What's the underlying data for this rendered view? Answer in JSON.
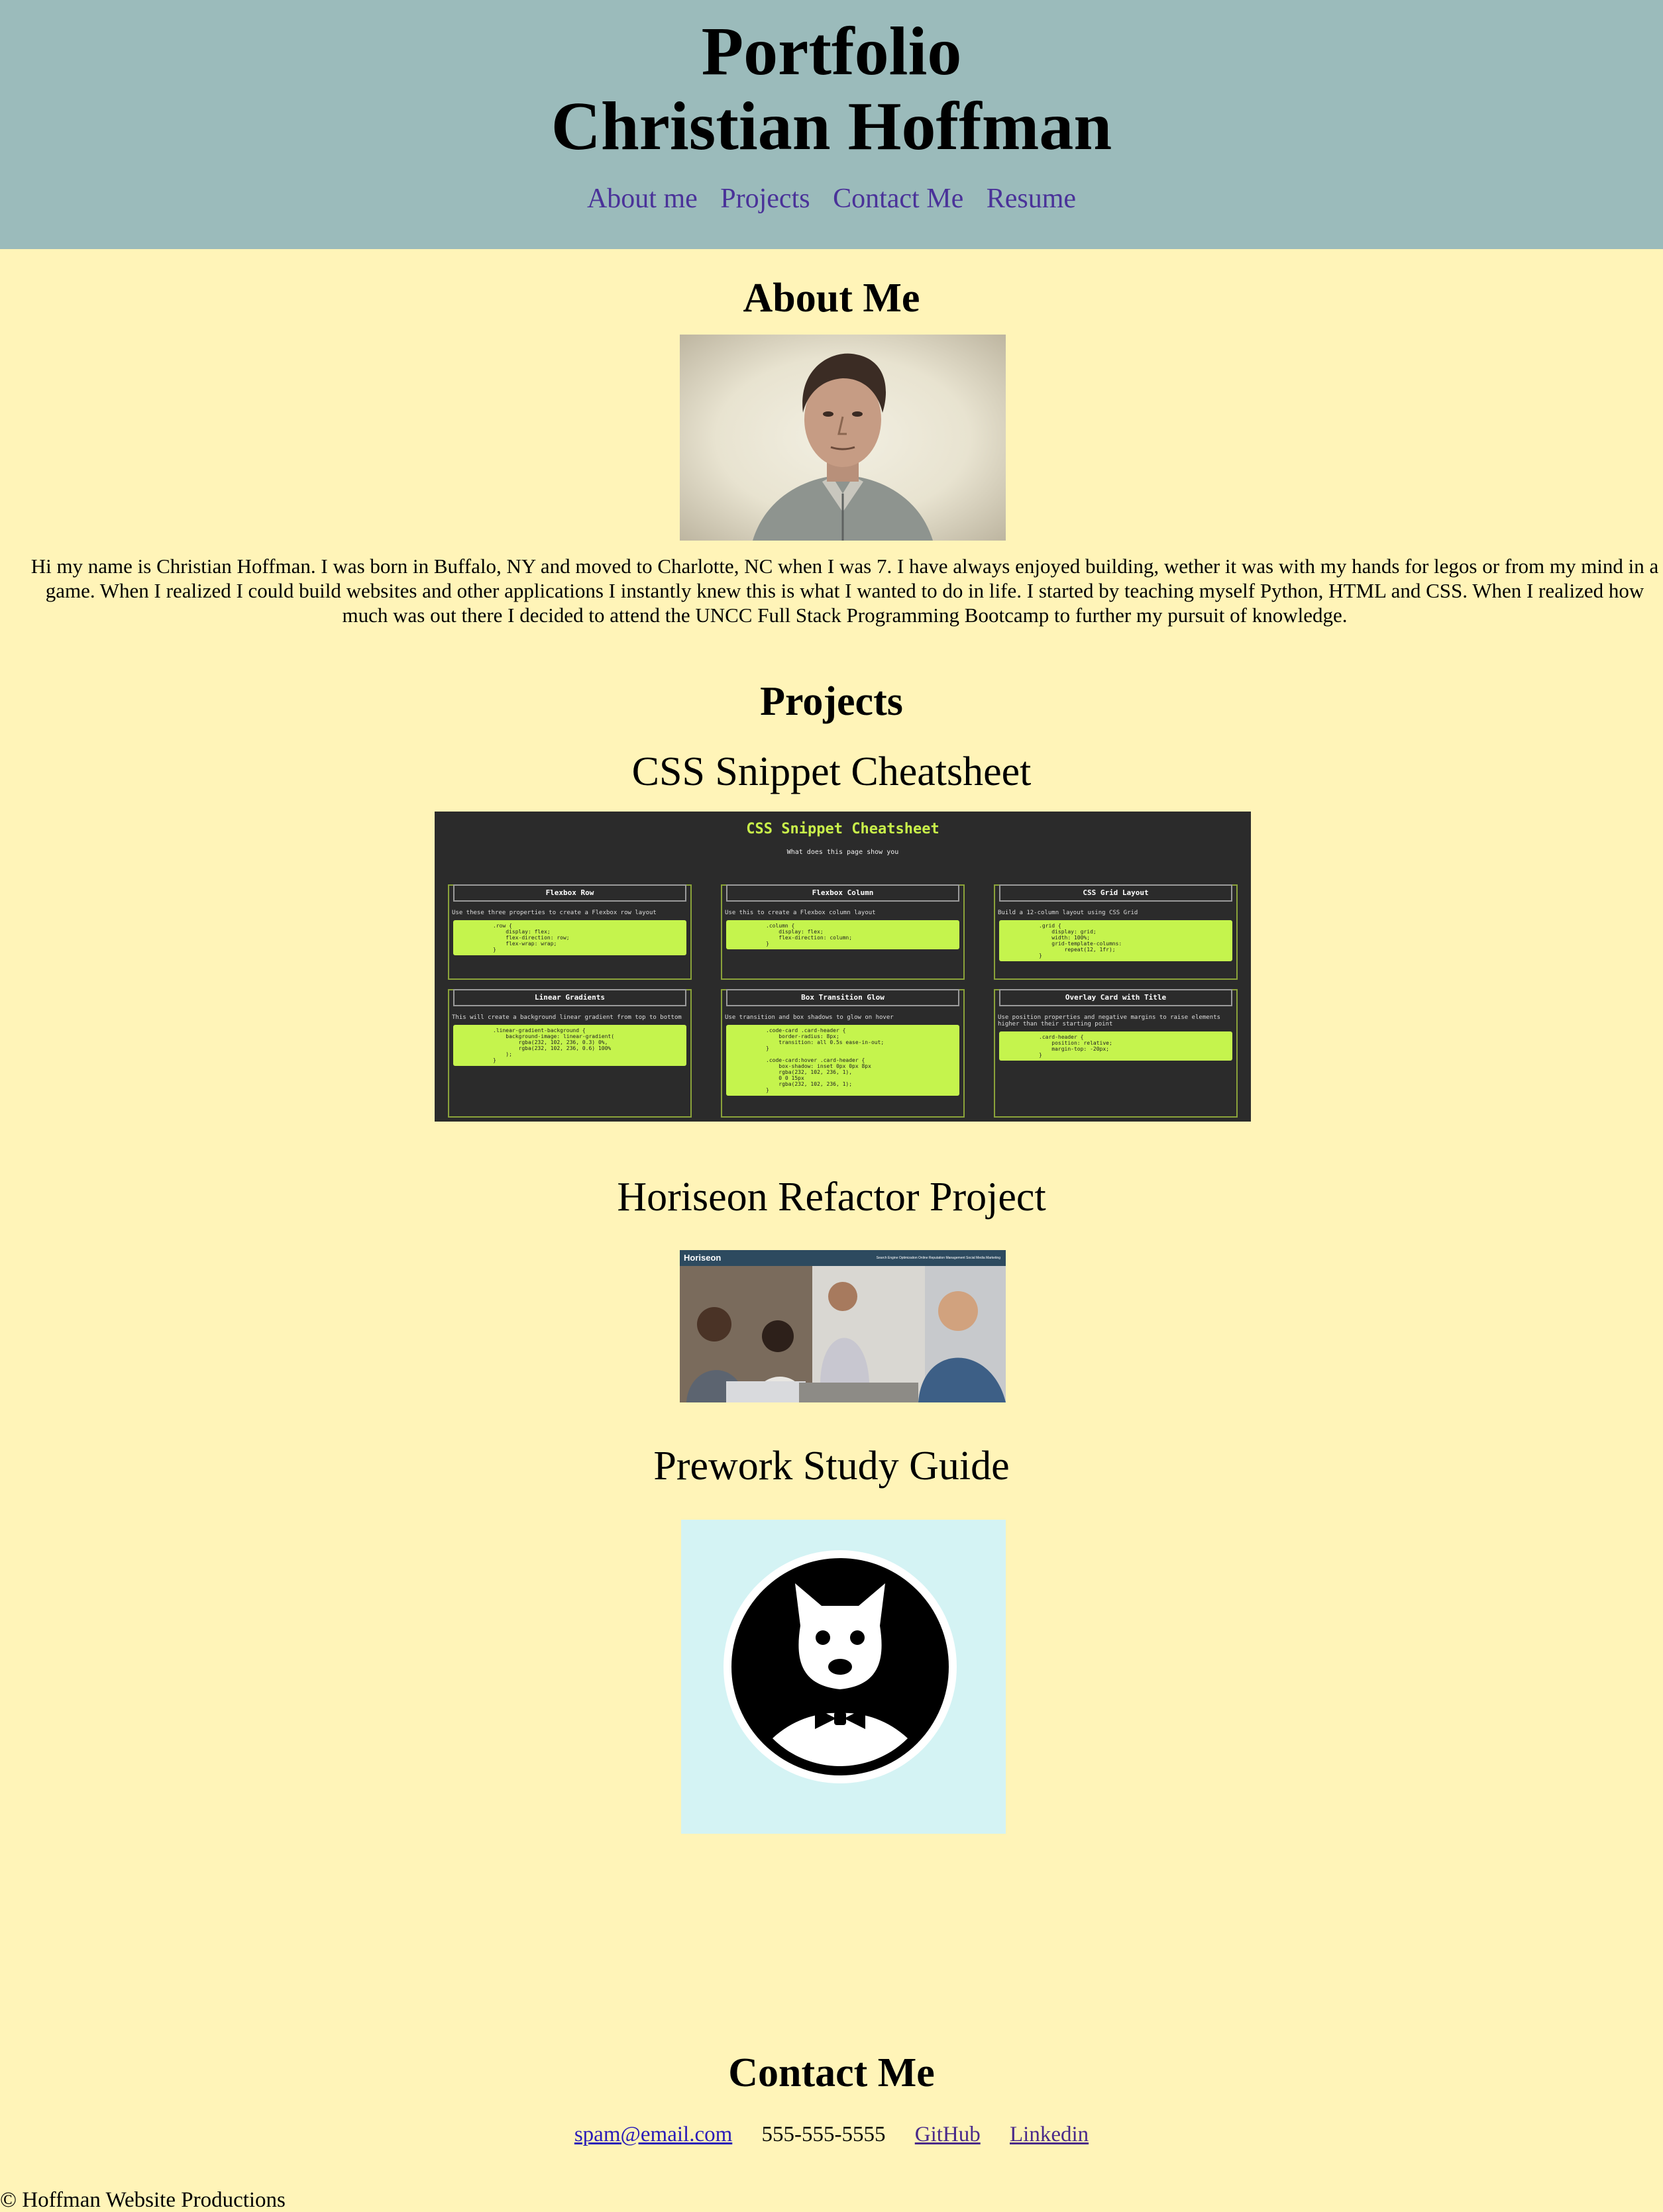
{
  "header": {
    "title_line1": "Portfolio",
    "title_line2": "Christian Hoffman",
    "nav": {
      "about": "About me",
      "projects": "Projects",
      "contact": "Contact Me",
      "resume": "Resume"
    }
  },
  "about": {
    "heading": "About Me",
    "text": "Hi my name is Christian Hoffman. I was born in Buffalo, NY and moved to Charlotte, NC when I was 7. I have always enjoyed building, wether it was with my hands for legos or from my mind in a game. When I realized I could build websites and other applications I instantly knew this is what I wanted to do in life. I started by teaching myself Python, HTML and CSS. When I realized how much was out there I decided to attend the UNCC Full Stack Programming Bootcamp to further my pursuit of knowledge."
  },
  "projects": {
    "heading": "Projects",
    "items": [
      {
        "title": "CSS Snippet Cheatsheet",
        "screenshot": {
          "title": "CSS Snippet Cheatsheet",
          "subtitle": "What does this page show you",
          "cards": [
            {
              "header": "Flexbox Row",
              "desc": "Use these three properties to create a Flexbox row layout",
              "code": ".row {\n    display: flex;\n    flex-direction: row;\n    flex-wrap: wrap;\n}"
            },
            {
              "header": "Flexbox Column",
              "desc": "Use this to create a Flexbox column layout",
              "code": ".column {\n    display: flex;\n    flex-direction: column;\n}"
            },
            {
              "header": "CSS Grid Layout",
              "desc": "Build a 12-column layout using CSS Grid",
              "code": ".grid {\n    display: grid;\n    width: 100%;\n    grid-template-columns:\n        repeat(12, 1fr);\n}"
            },
            {
              "header": "Linear Gradients",
              "desc": "This will create a background linear gradient from top to bottom",
              "code": ".linear-gradient-background {\n    background-image: linear-gradient(\n        rgba(232, 102, 236, 0.3) 0%,\n        rgba(232, 102, 236, 0.6) 100%\n    );\n}"
            },
            {
              "header": "Box Transition Glow",
              "desc": "Use transition and box shadows to glow on hover",
              "code": ".code-card .card-header {\n    border-radius: 8px;\n    transition: all 0.5s ease-in-out;\n}\n\n.code-card:hover .card-header {\n    box-shadow: inset 0px 0px 8px\n    rgba(232, 102, 236, 1),\n    0 0 15px\n    rgba(232, 102, 236, 1);\n}"
            },
            {
              "header": "Overlay Card with Title",
              "desc": "Use position properties and negative margins to raise elements higher than their starting point",
              "code": ".card-header {\n    position: relative;\n    margin-top: -20px;\n}"
            }
          ]
        }
      },
      {
        "title": "Horiseon Refactor Project",
        "screenshot": {
          "brand": "Horiseon",
          "nav": "Search Engine Optimization    Online Reputation Management    Social Media Marketing"
        }
      },
      {
        "title": "Prework Study Guide"
      }
    ]
  },
  "contact": {
    "heading": "Contact Me",
    "email": "spam@email.com",
    "phone": "555-555-5555",
    "github": "GitHub",
    "linkedin": "Linkedin"
  },
  "footer": {
    "text": "© Hoffman Website Productions"
  }
}
